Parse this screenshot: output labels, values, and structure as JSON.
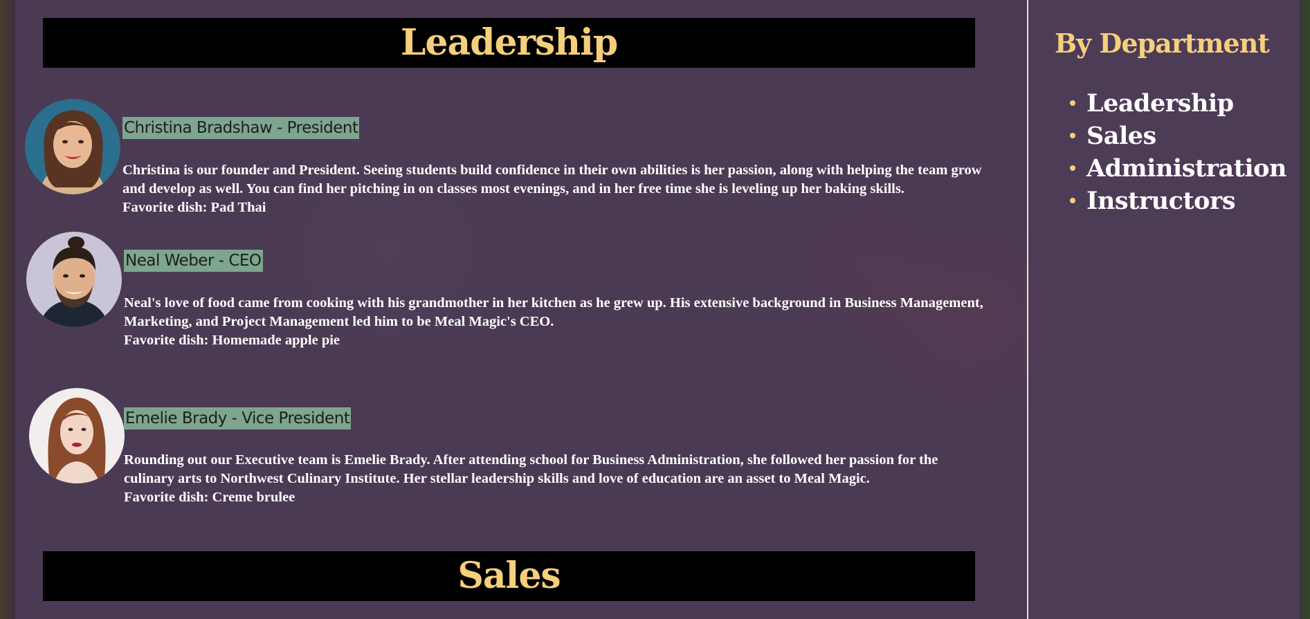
{
  "colors": {
    "accent": "#f6cf7d",
    "header_bg": "#000000",
    "name_tag_bg": "#7ea58f",
    "panel_bg": "#503e5a",
    "text": "#ffffff"
  },
  "main": {
    "sections": [
      {
        "title": "Leadership",
        "people": [
          {
            "name_title": "Christina Bradshaw - President",
            "bio": "Christina is our founder and President. Seeing students build confidence in their own abilities is her passion, along with helping the team grow and develop as well. You can find her pitching in on classes most evenings, and in her free time she is leveling up her baking skills.",
            "favorite_dish": "Favorite dish: Pad Thai",
            "avatar_icon": "woman-portrait-icon"
          },
          {
            "name_title": "Neal Weber - CEO",
            "bio": "Neal's love of food came from cooking with his grandmother in her kitchen as he grew up. His extensive background in Business Management, Marketing, and Project Management led him to be Meal Magic's CEO.",
            "favorite_dish": "Favorite dish: Homemade apple pie",
            "avatar_icon": "man-portrait-icon"
          },
          {
            "name_title": "Emelie Brady - Vice President",
            "bio": "Rounding out our Executive team is Emelie Brady. After attending school for Business Administration, she followed her passion for the culinary arts to Northwest Culinary Institute. Her stellar leadership skills and love of education are an asset to Meal Magic.",
            "favorite_dish": "Favorite dish: Creme brulee",
            "avatar_icon": "woman-portrait-icon"
          }
        ]
      },
      {
        "title": "Sales"
      }
    ]
  },
  "sidebar": {
    "title": "By Department",
    "items": [
      {
        "label": "Leadership"
      },
      {
        "label": "Sales"
      },
      {
        "label": "Administration"
      },
      {
        "label": "Instructors"
      }
    ]
  }
}
